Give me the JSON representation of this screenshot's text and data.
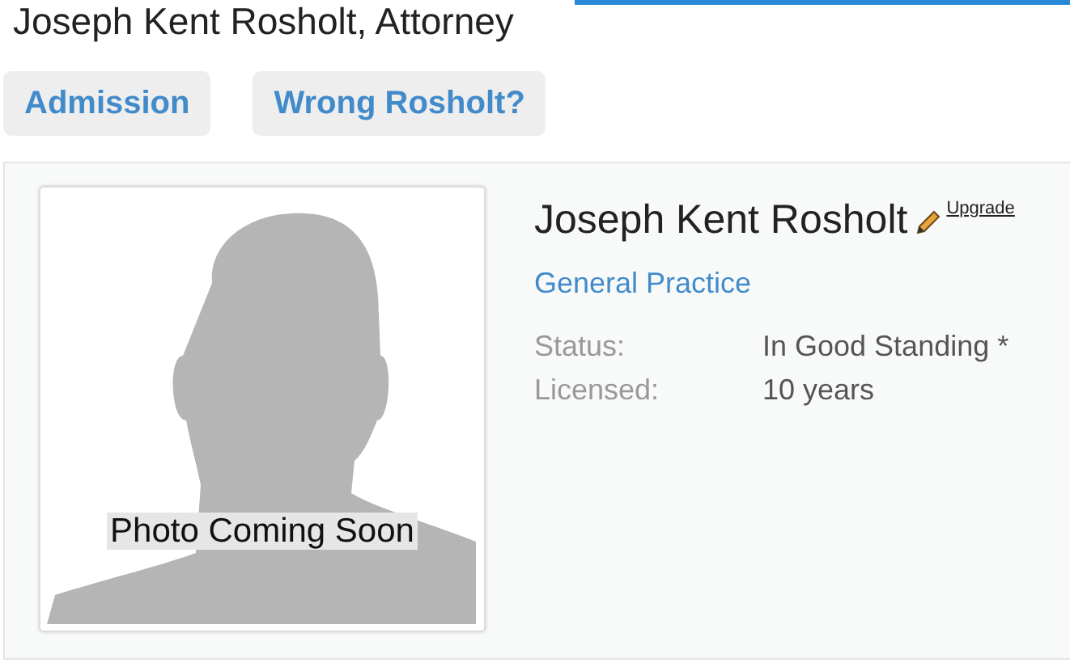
{
  "page": {
    "title": "Joseph Kent Rosholt, Attorney"
  },
  "buttons": [
    {
      "label": "Admission"
    },
    {
      "label": "Wrong Rosholt?"
    }
  ],
  "profile": {
    "photo_caption": "Photo Coming Soon",
    "name": "Joseph Kent Rosholt",
    "upgrade_link": "Upgrade",
    "practice_area": "General Practice",
    "details": [
      {
        "label": "Status:",
        "value": "In Good Standing *"
      },
      {
        "label": "Licensed:",
        "value": "10 years"
      }
    ]
  }
}
